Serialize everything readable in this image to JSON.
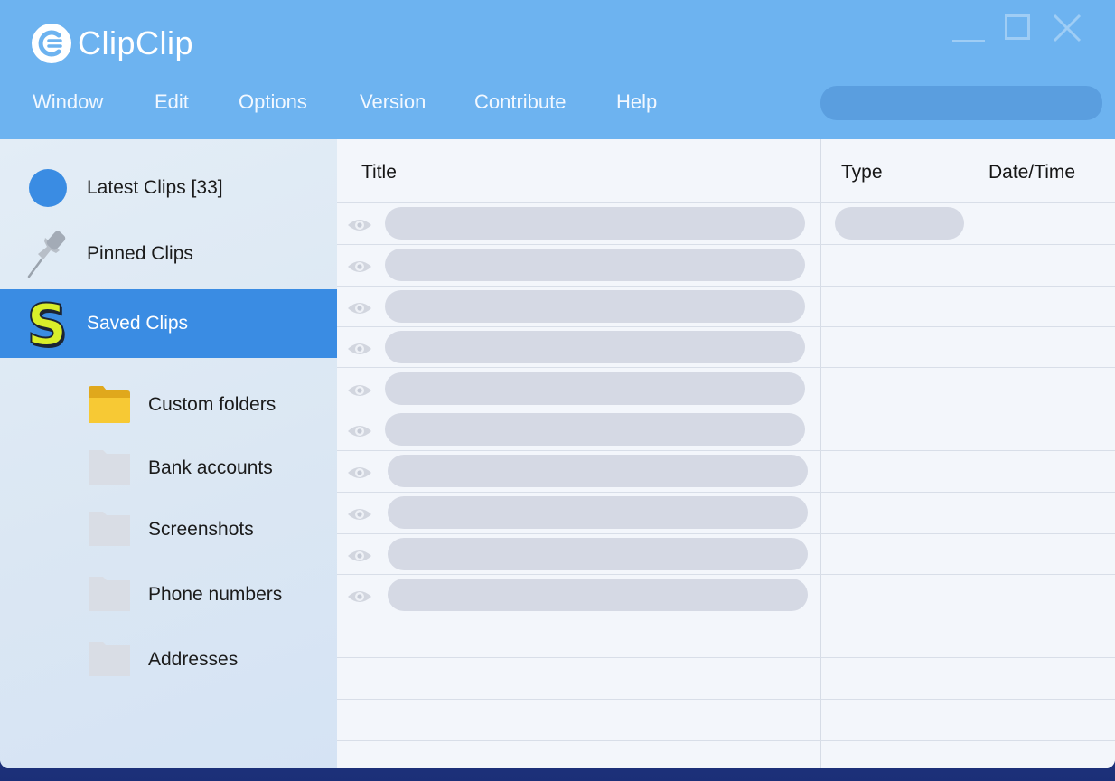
{
  "app": {
    "name": "ClipClip",
    "accent_color": "#3a8ce3",
    "header_color": "#6db3f0"
  },
  "window_controls": {
    "icons": [
      "minimize-icon",
      "maximize-icon",
      "close-icon"
    ]
  },
  "menu": {
    "items": [
      {
        "label": "Window"
      },
      {
        "label": "Edit"
      },
      {
        "label": "Options"
      },
      {
        "label": "Version"
      },
      {
        "label": "Contribute"
      },
      {
        "label": "Help"
      }
    ]
  },
  "search": {
    "placeholder": "",
    "value": ""
  },
  "sidebar": {
    "items": [
      {
        "label": "Latest Clips [33]",
        "icon": "circle-icon"
      },
      {
        "label": "Pinned Clips",
        "icon": "pin-icon"
      },
      {
        "label": "Saved Clips",
        "icon": "saved-s-icon",
        "active": true
      }
    ],
    "folders": [
      {
        "label": "Custom folders",
        "icon": "folder-open-icon"
      },
      {
        "label": "Bank accounts",
        "icon": "folder-icon"
      },
      {
        "label": "Screenshots",
        "icon": "folder-icon"
      },
      {
        "label": "Phone numbers",
        "icon": "folder-icon"
      },
      {
        "label": "Addresses",
        "icon": "folder-icon"
      }
    ]
  },
  "table": {
    "columns": [
      {
        "label": "Title"
      },
      {
        "label": "Type"
      },
      {
        "label": "Date/Time"
      }
    ],
    "rows": [
      {
        "title": "",
        "type": "",
        "datetime": "",
        "icon": "eye-icon"
      },
      {
        "title": "",
        "type": "",
        "datetime": "",
        "icon": "eye-icon"
      },
      {
        "title": "",
        "type": "",
        "datetime": "",
        "icon": "eye-icon"
      },
      {
        "title": "",
        "type": "",
        "datetime": "",
        "icon": "eye-icon"
      },
      {
        "title": "",
        "type": "",
        "datetime": "",
        "icon": "eye-icon"
      },
      {
        "title": "",
        "type": "",
        "datetime": "",
        "icon": "eye-icon"
      },
      {
        "title": "",
        "type": "",
        "datetime": "",
        "icon": "eye-icon"
      },
      {
        "title": "",
        "type": "",
        "datetime": "",
        "icon": "eye-icon"
      },
      {
        "title": "",
        "type": "",
        "datetime": "",
        "icon": "eye-icon"
      },
      {
        "title": "",
        "type": "",
        "datetime": "",
        "icon": "eye-icon"
      }
    ]
  }
}
